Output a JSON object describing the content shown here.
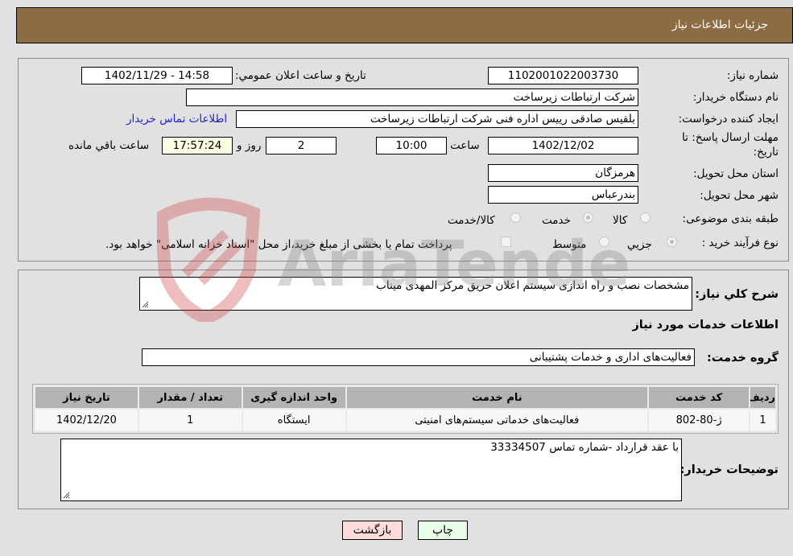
{
  "header": {
    "title": "جزئیات اطلاعات نیاز"
  },
  "form": {
    "need_number": {
      "label": "شماره نیاز:",
      "value": "1102001022003730"
    },
    "announce_datetime": {
      "label": "تاریخ و ساعت اعلان عمومي:",
      "value": "1402/11/29 - 14:58"
    },
    "buyer_org": {
      "label": "نام دستگاه خريدار:",
      "value": "شرکت ارتباطات زیرساخت"
    },
    "requester": {
      "label": "ایجاد کننده درخواست:",
      "value": "بلقیس صادقی رییس اداره فنی شرکت ارتباطات زیرساخت"
    },
    "buyer_contact_link": "اطلاعات تماس خریدار",
    "deadline": {
      "label_line1": "مهلت ارسال پاسخ: تا",
      "label_line2": "تاریخ:",
      "date": "1402/12/02",
      "time_label": "ساعت",
      "time": "10:00",
      "days": "2",
      "days_label": "روز و",
      "remaining": "17:57:24",
      "remaining_label": "ساعت باقي مانده"
    },
    "province": {
      "label": "استان محل تحویل:",
      "value": "هرمزگان"
    },
    "city": {
      "label": "شهر محل تحویل:",
      "value": "بندرعباس"
    },
    "category": {
      "label": "طبقه بندی موضوعی:",
      "options": [
        {
          "label": "کالا",
          "checked": false
        },
        {
          "label": "خدمت",
          "checked": true
        },
        {
          "label": "کالا/خدمت",
          "checked": false
        }
      ]
    },
    "purchase_type": {
      "label": "نوع فرآیند خرید :",
      "options": [
        {
          "label": "جزيي",
          "checked": true
        },
        {
          "label": "متوسط",
          "checked": false
        }
      ],
      "treasury_checkbox_label": "پرداخت تمام یا بخشی از مبلغ خرید،از محل \"اسناد خزانه اسلامی\" خواهد بود.",
      "treasury_checked": false
    }
  },
  "details": {
    "description": {
      "label": "شرح کلي نياز:",
      "value": "مشخصات نصب و راه اندازی سیستم اعلان حریق مرکز المهدی میناب"
    },
    "services_heading": "اطلاعات خدمات مورد نیاز",
    "service_group": {
      "label": "گروه خدمت:",
      "value": "فعالیت‌های اداری و خدمات پشتیبانی"
    },
    "table": {
      "headers": [
        "ردیف",
        "کد خدمت",
        "نام خدمت",
        "واحد اندازه گیری",
        "تعداد / مقدار",
        "تاریخ نیاز"
      ],
      "rows": [
        [
          "1",
          "ژ-80-802",
          "فعالیت‌های خدماتی سیستم‌های امنیتی",
          "ایستگاه",
          "1",
          "1402/12/20"
        ]
      ]
    },
    "buyer_notes": {
      "label": "توضیحات خریدار:",
      "value": "با عقد قرارداد -شماره تماس 33334507"
    }
  },
  "buttons": {
    "print": "چاپ",
    "back": "بازگشت"
  },
  "watermark": {
    "text": "AriaTender.neT"
  }
}
